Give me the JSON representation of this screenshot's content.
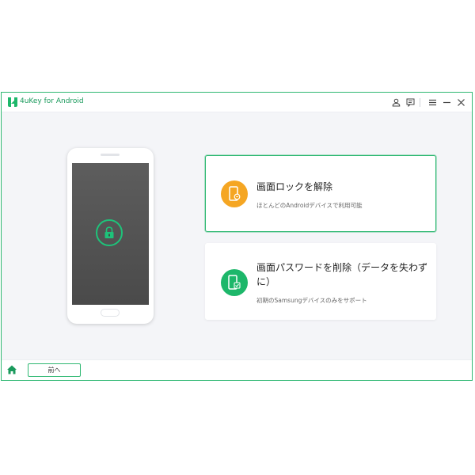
{
  "app": {
    "title": "4uKey for Android"
  },
  "titlebar": {
    "icons": [
      "user-icon",
      "feedback-icon",
      "menu-icon",
      "minimize-icon",
      "close-icon"
    ]
  },
  "phone": {
    "screen_icon": "lock-icon"
  },
  "options": [
    {
      "title": "画面ロックを解除",
      "description": "ほとんどのAndroidデバイスで利用可能",
      "icon": "phone-unlock-icon",
      "icon_color": "#f5a623",
      "selected": true
    },
    {
      "title": "画面パスワードを削除（データを失わずに）",
      "description": "初期のSamsungデバイスのみをサポート",
      "icon": "phone-verified-icon",
      "icon_color": "#1db76a",
      "selected": false
    }
  ],
  "bottombar": {
    "back_label": "前へ",
    "home_icon": "home-icon"
  },
  "colors": {
    "accent": "#2fb872",
    "background": "#f4f5f8"
  }
}
